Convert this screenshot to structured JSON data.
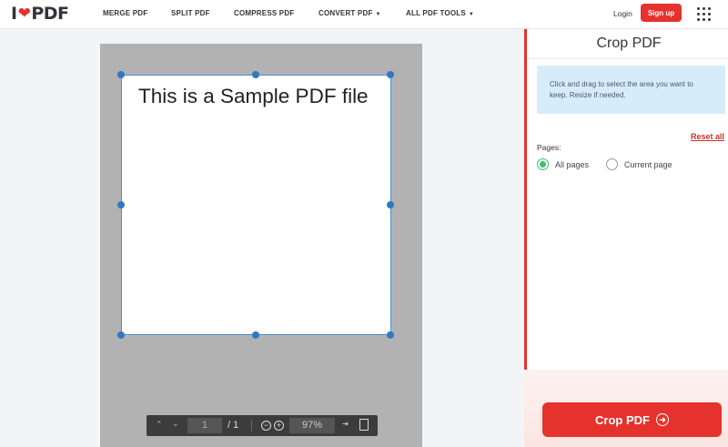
{
  "header": {
    "logo": {
      "left": "I",
      "right": "PDF"
    },
    "nav": [
      {
        "label": "MERGE PDF",
        "dropdown": false
      },
      {
        "label": "SPLIT PDF",
        "dropdown": false
      },
      {
        "label": "COMPRESS PDF",
        "dropdown": false
      },
      {
        "label": "CONVERT PDF",
        "dropdown": true
      },
      {
        "label": "ALL PDF TOOLS",
        "dropdown": true
      }
    ],
    "login_label": "Login",
    "signup_label": "Sign up",
    "apps_icon": "grid-dots-icon"
  },
  "document": {
    "page_text": "This is a Sample PDF file"
  },
  "viewer_toolbar": {
    "current_page": "1",
    "total_pages": "/ 1",
    "zoom": "97%",
    "icons": [
      "chevron-up-icon",
      "chevron-down-icon",
      "zoom-out-icon",
      "zoom-in-icon",
      "fit-width-icon",
      "fit-page-icon"
    ]
  },
  "sidebar": {
    "title": "Crop PDF",
    "info": "Click and drag to select the area you want to keep. Resize if needed.",
    "reset_label": "Reset all",
    "pages_label": "Pages:",
    "options": [
      {
        "label": "All pages",
        "selected": true
      },
      {
        "label": "Current page",
        "selected": false
      }
    ],
    "action_label": "Crop PDF"
  },
  "colors": {
    "brand_red": "#e5322d",
    "selection_blue": "#2f78c4",
    "radio_green": "#3fbf6f",
    "info_bg": "#d7ecf9"
  }
}
